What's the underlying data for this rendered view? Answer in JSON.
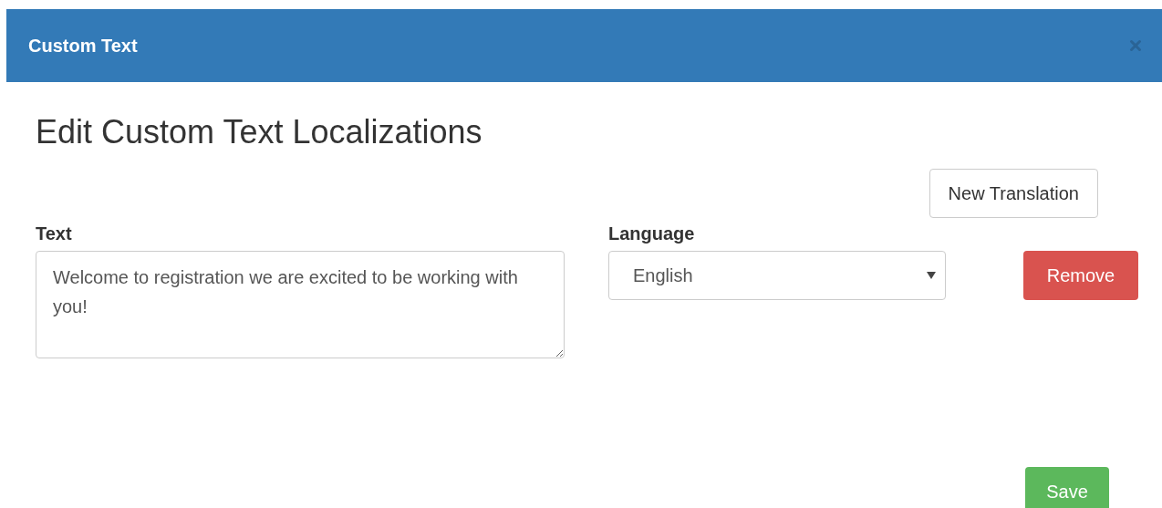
{
  "dialog": {
    "title": "Custom Text"
  },
  "heading": "Edit Custom Text Localizations",
  "new_translation_button": "New Translation",
  "text_field": {
    "label": "Text",
    "value": "Welcome to registration we are excited to be working with you!"
  },
  "language_field": {
    "label": "Language",
    "value": "English"
  },
  "remove_button": "Remove",
  "save_button": "Save"
}
